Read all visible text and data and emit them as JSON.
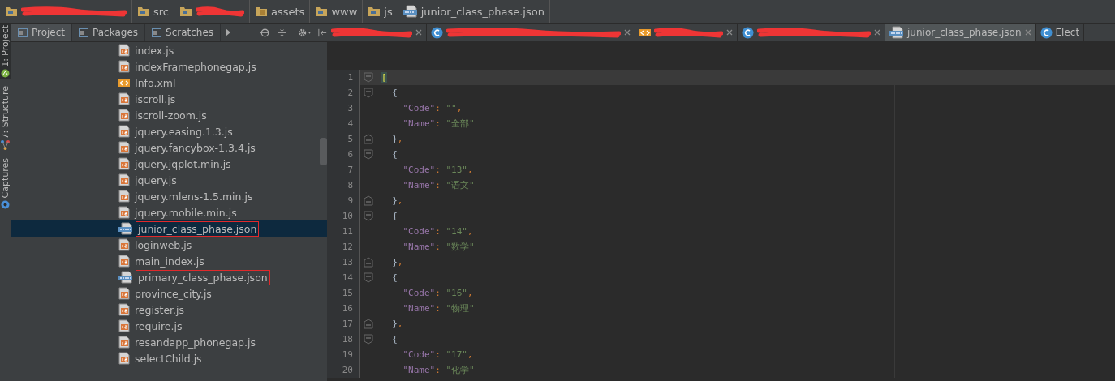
{
  "breadcrumb": [
    {
      "kind": "hidden"
    },
    {
      "label": "src",
      "kind": "folder"
    },
    {
      "kind": "hidden"
    },
    {
      "label": "assets",
      "kind": "resources"
    },
    {
      "label": "www",
      "kind": "folder"
    },
    {
      "label": "js",
      "kind": "folder"
    },
    {
      "label": "junior_class_phase.json",
      "kind": "json"
    }
  ],
  "side_strip": [
    {
      "label": "1: Project",
      "selected": true,
      "kind": "android"
    },
    {
      "label": "7: Structure",
      "selected": false,
      "kind": "structure"
    },
    {
      "label": "Captures",
      "selected": false,
      "kind": "capture"
    }
  ],
  "panel_tabs": [
    {
      "label": "Project",
      "selected": true
    },
    {
      "label": "Packages",
      "selected": false
    },
    {
      "label": "Scratches",
      "selected": false
    }
  ],
  "editor_tabs": [
    {
      "kind": "fragment",
      "selected": false
    },
    {
      "kind": "class",
      "selected": false
    },
    {
      "kind": "xml",
      "selected": false
    },
    {
      "kind": "class",
      "selected": false
    },
    {
      "kind": "json",
      "label": "junior_class_phase.json",
      "selected": true
    },
    {
      "kind": "class",
      "label": "Elect",
      "selected": false
    }
  ],
  "tree": [
    {
      "label": "index.js",
      "kind": "js",
      "selected": false,
      "marked": false
    },
    {
      "label": "indexFramephonegap.js",
      "kind": "js",
      "selected": false,
      "marked": false
    },
    {
      "label": "Info.xml",
      "kind": "xml",
      "selected": false,
      "marked": false
    },
    {
      "label": "iscroll.js",
      "kind": "js",
      "selected": false,
      "marked": false
    },
    {
      "label": "iscroll-zoom.js",
      "kind": "js",
      "selected": false,
      "marked": false
    },
    {
      "label": "jquery.easing.1.3.js",
      "kind": "js",
      "selected": false,
      "marked": false
    },
    {
      "label": "jquery.fancybox-1.3.4.js",
      "kind": "js",
      "selected": false,
      "marked": false
    },
    {
      "label": "jquery.jqplot.min.js",
      "kind": "js",
      "selected": false,
      "marked": false
    },
    {
      "label": "jquery.js",
      "kind": "js",
      "selected": false,
      "marked": false
    },
    {
      "label": "jquery.mlens-1.5.min.js",
      "kind": "js",
      "selected": false,
      "marked": false
    },
    {
      "label": "jquery.mobile.min.js",
      "kind": "js",
      "selected": false,
      "marked": false
    },
    {
      "label": "junior_class_phase.json",
      "kind": "json",
      "selected": true,
      "marked": true
    },
    {
      "label": "loginweb.js",
      "kind": "js",
      "selected": false,
      "marked": false
    },
    {
      "label": "main_index.js",
      "kind": "js",
      "selected": false,
      "marked": false
    },
    {
      "label": "primary_class_phase.json",
      "kind": "json",
      "selected": false,
      "marked": true
    },
    {
      "label": "province_city.js",
      "kind": "js",
      "selected": false,
      "marked": false
    },
    {
      "label": "register.js",
      "kind": "js",
      "selected": false,
      "marked": false
    },
    {
      "label": "require.js",
      "kind": "js",
      "selected": false,
      "marked": false
    },
    {
      "label": "resandapp_phonegap.js",
      "kind": "js",
      "selected": false,
      "marked": false
    },
    {
      "label": "selectChild.js",
      "kind": "js",
      "selected": false,
      "marked": false
    }
  ],
  "code_lines": [
    {
      "number": "1",
      "kind": "open",
      "current": true,
      "tokens": [
        {
          "kind": "bracket",
          "text": "["
        }
      ]
    },
    {
      "number": "2",
      "kind": "open",
      "current": false,
      "tokens": [
        {
          "kind": "plain",
          "text": "{"
        }
      ]
    },
    {
      "number": "3",
      "kind": "member",
      "current": false,
      "tokens": [
        {
          "kind": "key",
          "text": "\"Code\""
        },
        {
          "kind": "punct",
          "text": ":"
        },
        {
          "kind": "string",
          "text": "\"\""
        },
        {
          "kind": "punct",
          "text": ","
        }
      ]
    },
    {
      "number": "4",
      "kind": "member",
      "current": false,
      "tokens": [
        {
          "kind": "key",
          "text": "\"Name\""
        },
        {
          "kind": "punct",
          "text": ":"
        },
        {
          "kind": "string",
          "text": "\"全部\""
        }
      ]
    },
    {
      "number": "5",
      "kind": "close",
      "current": false,
      "tokens": [
        {
          "kind": "plain",
          "text": "}"
        },
        {
          "kind": "punct",
          "text": ","
        }
      ]
    },
    {
      "number": "6",
      "kind": "open",
      "current": false,
      "tokens": [
        {
          "kind": "plain",
          "text": "{"
        }
      ]
    },
    {
      "number": "7",
      "kind": "member",
      "current": false,
      "tokens": [
        {
          "kind": "key",
          "text": "\"Code\""
        },
        {
          "kind": "punct",
          "text": ":"
        },
        {
          "kind": "string",
          "text": "\"13\""
        },
        {
          "kind": "punct",
          "text": ","
        }
      ]
    },
    {
      "number": "8",
      "kind": "member",
      "current": false,
      "tokens": [
        {
          "kind": "key",
          "text": "\"Name\""
        },
        {
          "kind": "punct",
          "text": ":"
        },
        {
          "kind": "string",
          "text": "\"语文\""
        }
      ]
    },
    {
      "number": "9",
      "kind": "close",
      "current": false,
      "tokens": [
        {
          "kind": "plain",
          "text": "}"
        },
        {
          "kind": "punct",
          "text": ","
        }
      ]
    },
    {
      "number": "10",
      "kind": "open",
      "current": false,
      "tokens": [
        {
          "kind": "plain",
          "text": "{"
        }
      ]
    },
    {
      "number": "11",
      "kind": "member",
      "current": false,
      "tokens": [
        {
          "kind": "key",
          "text": "\"Code\""
        },
        {
          "kind": "punct",
          "text": ":"
        },
        {
          "kind": "string",
          "text": "\"14\""
        },
        {
          "kind": "punct",
          "text": ","
        }
      ]
    },
    {
      "number": "12",
      "kind": "member",
      "current": false,
      "tokens": [
        {
          "kind": "key",
          "text": "\"Name\""
        },
        {
          "kind": "punct",
          "text": ":"
        },
        {
          "kind": "string",
          "text": "\"数学\""
        }
      ]
    },
    {
      "number": "13",
      "kind": "close",
      "current": false,
      "tokens": [
        {
          "kind": "plain",
          "text": "}"
        },
        {
          "kind": "punct",
          "text": ","
        }
      ]
    },
    {
      "number": "14",
      "kind": "open",
      "current": false,
      "tokens": [
        {
          "kind": "plain",
          "text": "{"
        }
      ]
    },
    {
      "number": "15",
      "kind": "member",
      "current": false,
      "tokens": [
        {
          "kind": "key",
          "text": "\"Code\""
        },
        {
          "kind": "punct",
          "text": ":"
        },
        {
          "kind": "string",
          "text": "\"16\""
        },
        {
          "kind": "punct",
          "text": ","
        }
      ]
    },
    {
      "number": "16",
      "kind": "member",
      "current": false,
      "tokens": [
        {
          "kind": "key",
          "text": "\"Name\""
        },
        {
          "kind": "punct",
          "text": ":"
        },
        {
          "kind": "string",
          "text": "\"物理\""
        }
      ]
    },
    {
      "number": "17",
      "kind": "close",
      "current": false,
      "tokens": [
        {
          "kind": "plain",
          "text": "}"
        },
        {
          "kind": "punct",
          "text": ","
        }
      ]
    },
    {
      "number": "18",
      "kind": "open",
      "current": false,
      "tokens": [
        {
          "kind": "plain",
          "text": "{"
        }
      ]
    },
    {
      "number": "19",
      "kind": "member",
      "current": false,
      "tokens": [
        {
          "kind": "key",
          "text": "\"Code\""
        },
        {
          "kind": "punct",
          "text": ":"
        },
        {
          "kind": "string",
          "text": "\"17\""
        },
        {
          "kind": "punct",
          "text": ","
        }
      ]
    },
    {
      "number": "20",
      "kind": "member",
      "current": false,
      "tokens": [
        {
          "kind": "key",
          "text": "\"Name\""
        },
        {
          "kind": "punct",
          "text": ":"
        },
        {
          "kind": "string",
          "text": "\"化学\""
        }
      ]
    }
  ]
}
